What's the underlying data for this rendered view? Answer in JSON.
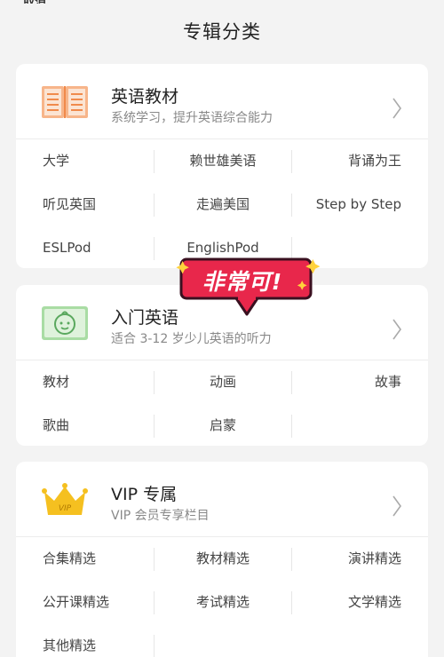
{
  "page": {
    "title": "专辑分类",
    "top_stub": "取消"
  },
  "badge": {
    "text": "非常可!"
  },
  "cards": [
    {
      "title": "英语教材",
      "subtitle": "系统学习，提升英语综合能力",
      "icon": "open-book-icon",
      "rows": [
        [
          "大学",
          "赖世雄美语",
          "背诵为王"
        ],
        [
          "听见英国",
          "走遍美国",
          "Step by Step"
        ],
        [
          "ESLPod",
          "EnglishPod",
          ""
        ]
      ]
    },
    {
      "title": "入门英语",
      "subtitle": "适合 3-12 岁少儿英语的听力",
      "icon": "baby-face-icon",
      "rows": [
        [
          "教材",
          "动画",
          "故事"
        ],
        [
          "歌曲",
          "启蒙",
          ""
        ]
      ]
    },
    {
      "title": "VIP 专属",
      "subtitle": "VIP 会员专享栏目",
      "icon": "vip-crown-icon",
      "rows": [
        [
          "合集精选",
          "教材精选",
          "演讲精选"
        ],
        [
          "公开课精选",
          "考试精选",
          "文学精选"
        ],
        [
          "其他精选",
          "",
          ""
        ]
      ]
    }
  ],
  "colors": {
    "accent_orange": "#f08a4b",
    "accent_green": "#6fbf73",
    "crown_gold": "#f5c020",
    "badge_red": "#e8274b"
  }
}
